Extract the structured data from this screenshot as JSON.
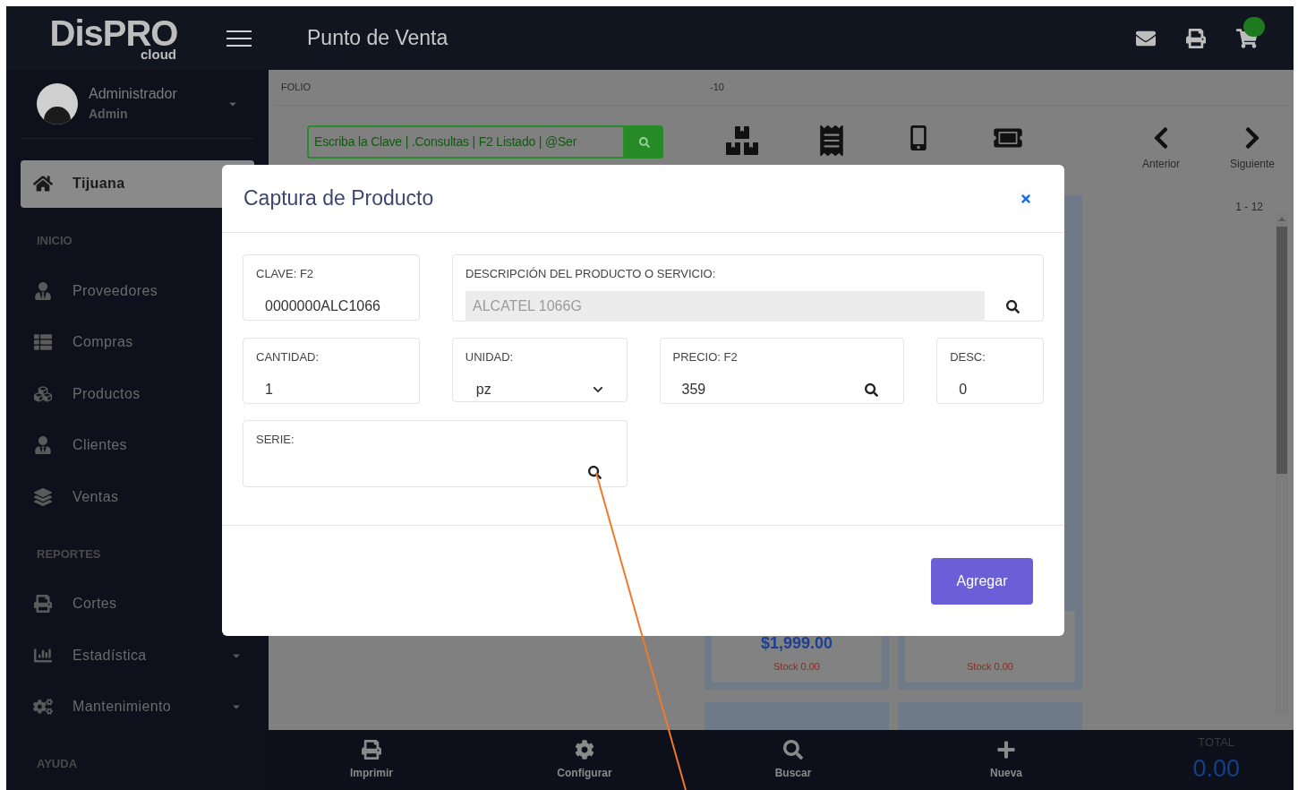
{
  "header": {
    "logo": "DisPRO",
    "logo_sub": "cloud",
    "title": "Punto de Venta",
    "cart_badge": true
  },
  "user": {
    "name": "Administrador",
    "role": "Admin"
  },
  "sidebar": {
    "items": [
      {
        "kind": "location",
        "label": "Tijuana",
        "selected": true,
        "expandable": false
      },
      {
        "kind": "section",
        "label": "INICIO"
      },
      {
        "kind": "item",
        "label": "Proveedores",
        "selected": false,
        "expandable": false
      },
      {
        "kind": "item",
        "label": "Compras",
        "selected": false,
        "expandable": false
      },
      {
        "kind": "item",
        "label": "Productos",
        "selected": false,
        "expandable": false
      },
      {
        "kind": "item",
        "label": "Clientes",
        "selected": false,
        "expandable": false
      },
      {
        "kind": "item",
        "label": "Ventas",
        "selected": false,
        "expandable": false
      },
      {
        "kind": "section",
        "label": "REPORTES"
      },
      {
        "kind": "item",
        "label": "Cortes",
        "selected": false,
        "expandable": false
      },
      {
        "kind": "item",
        "label": "Estadística",
        "selected": false,
        "expandable": true
      },
      {
        "kind": "item",
        "label": "Mantenimiento",
        "selected": false,
        "expandable": true
      },
      {
        "kind": "section",
        "label": "AYUDA"
      }
    ]
  },
  "folio": {
    "label": "FOLIO",
    "value": "-10"
  },
  "search": {
    "placeholder": "Escriba la Clave | .Consultas | F2 Listado | @Ser"
  },
  "nav": [
    {
      "label": "Anterior"
    },
    {
      "label": "Siguiente"
    }
  ],
  "page_range": "1 - 12",
  "products": [
    {
      "price": "$1,999.00",
      "stock": "Stock 0.00"
    },
    {
      "stock": "Stock 0.00"
    }
  ],
  "bottom_bar": {
    "actions": [
      "Imprimir",
      "Configurar",
      "Buscar",
      "Nueva"
    ],
    "total_label": "TOTAL",
    "total": "0.00"
  },
  "modal": {
    "title": "Captura de Producto",
    "fields": [
      {
        "kind": "text",
        "label": "CLAVE: F2",
        "value": "0000000ALC1066"
      },
      {
        "kind": "readonly",
        "label": "DESCRIPCIÓN DEL PRODUCTO O SERVICIO:",
        "value": "ALCATEL 1066G",
        "search": true
      },
      {
        "kind": "text",
        "label": "CANTIDAD:",
        "value": "1"
      },
      {
        "kind": "select",
        "label": "UNIDAD:",
        "value": "pz"
      },
      {
        "kind": "text",
        "label": "PRECIO: F2",
        "value": "359",
        "search": true
      },
      {
        "kind": "text",
        "label": "DESC:",
        "value": "0"
      },
      {
        "kind": "text",
        "label": "SERIE:",
        "search": true
      }
    ],
    "button": "Agregar"
  }
}
